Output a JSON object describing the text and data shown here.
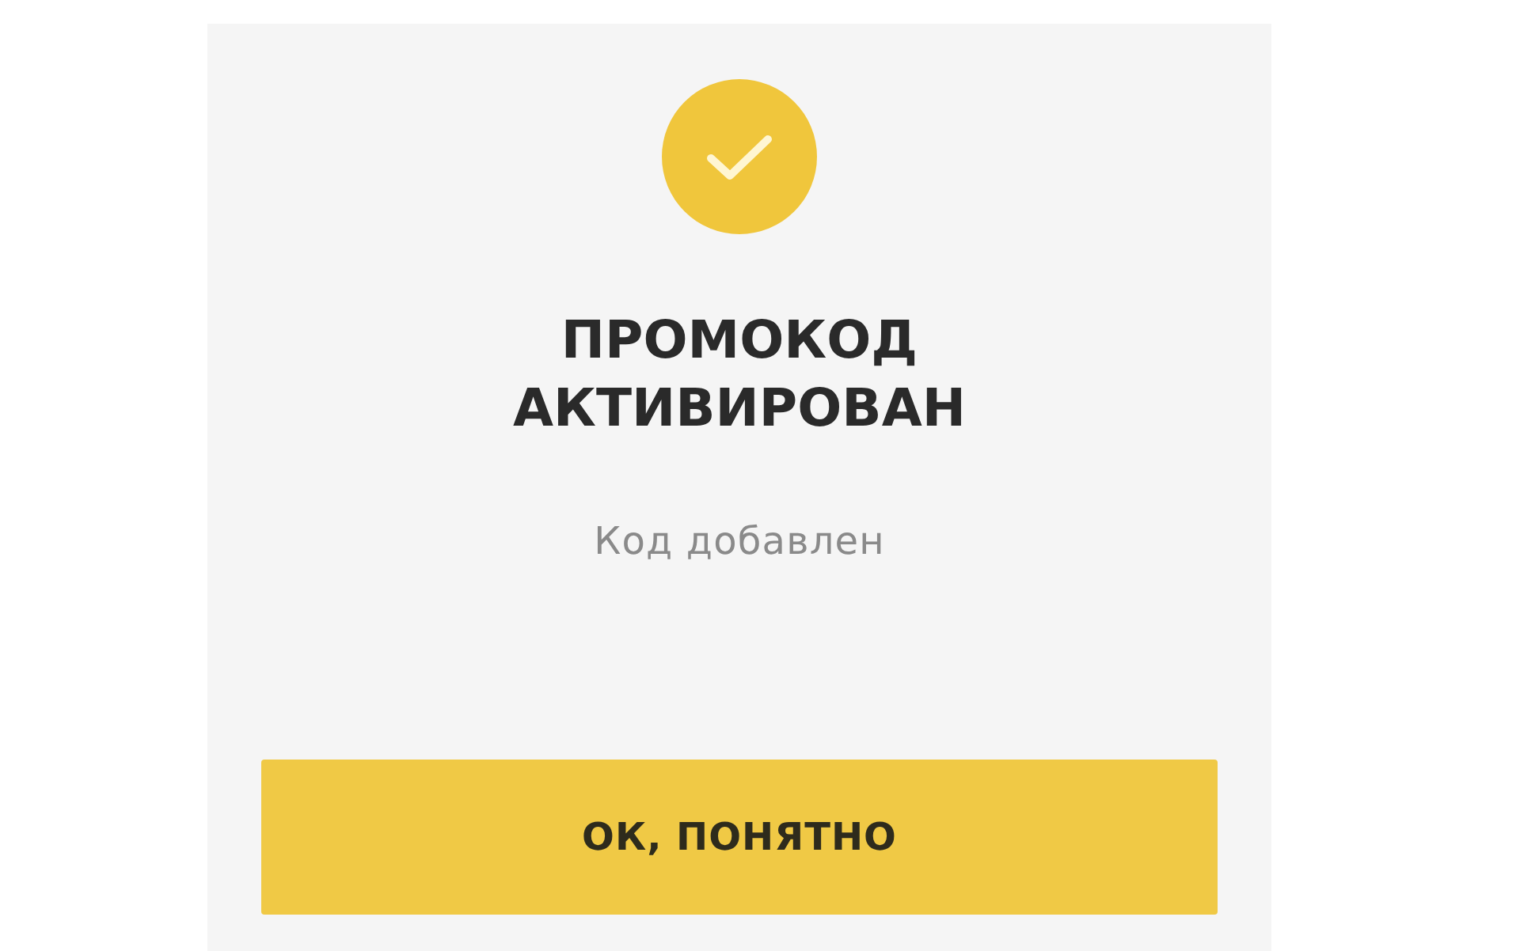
{
  "dialog": {
    "title": "ПРОМОКОД АКТИВИРОВАН",
    "message": "Код добавлен",
    "button": "ОК, ПОНЯТНО"
  }
}
